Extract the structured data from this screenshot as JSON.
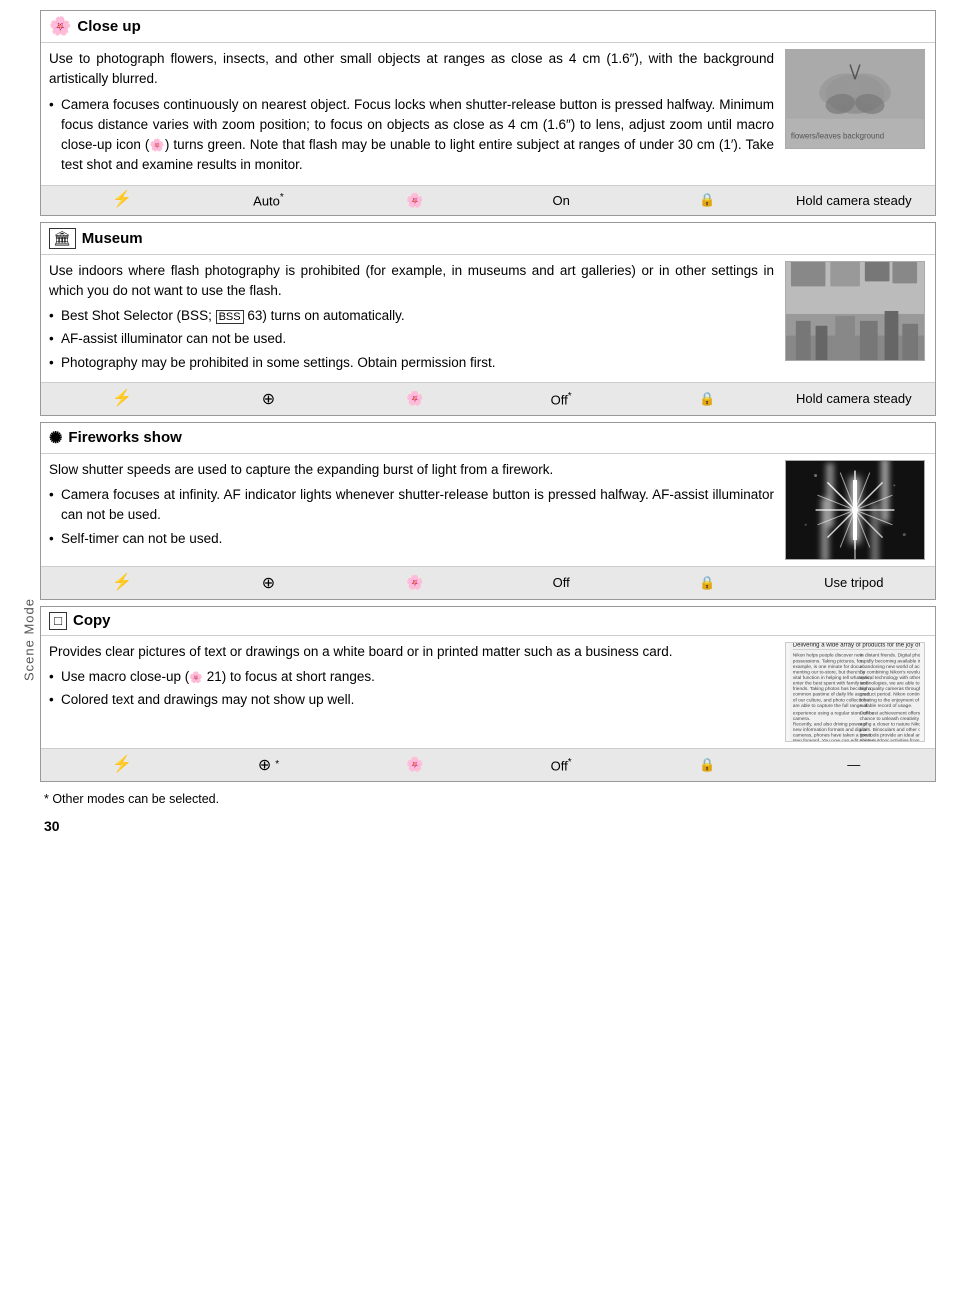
{
  "sections": [
    {
      "id": "close-up",
      "icon": "🌸",
      "title": "Close up",
      "paragraphs": [
        "Use to photograph flowers, insects, and other small objects at ranges as close as 4 cm (1.6\"), with the background artistically blurred.",
        "Camera focuses continuously on nearest object.  Focus locks when shutter-release button is pressed halfway. Minimum focus distance varies with zoom position; to focus on objects as close as 4 cm (1.6\") to lens, adjust zoom until macro close-up icon (🌸) turns green.  Note that flash may be unable to light entire subject at ranges of under 30 cm (1\").  Take test shot and examine results in monitor."
      ],
      "bullets": [],
      "status": {
        "flash": "⚡",
        "flash_label": "Auto*",
        "macro": "🌸",
        "macro_label": "On",
        "vr": "🔒",
        "vr_label": "Hold camera steady"
      },
      "image_type": "butterfly"
    },
    {
      "id": "museum",
      "icon": "🏛",
      "title": "Museum",
      "paragraphs": [
        "Use indoors where flash photography is prohibited (for example, in museums and art galleries) or in other settings in which you do not want to use the flash."
      ],
      "bullets": [
        "Best Shot Selector (BSS; 📷 63) turns on automatically.",
        "AF-assist illuminator can not be used.",
        "Photography may be prohibited in some settings.  Obtain permission first."
      ],
      "status": {
        "flash": "⚡",
        "flash_label": "⊕",
        "macro": "🌸",
        "macro_label": "Off*",
        "vr": "🔒",
        "vr_label": "Hold camera steady"
      },
      "image_type": "museum"
    },
    {
      "id": "fireworks",
      "icon": "✨",
      "title": "Fireworks show",
      "paragraphs": [
        "Slow shutter speeds are used to capture the expanding burst of light from a firework."
      ],
      "bullets": [
        "Camera focuses at infinity.  AF indicator lights whenever shutter-release button is pressed halfway.  AF-assist illuminator can not be used.",
        "Self-timer can not be used."
      ],
      "status": {
        "flash": "⚡",
        "flash_label": "⊕",
        "macro": "🌸",
        "macro_label": "Off",
        "vr": "🔒",
        "vr_label": "Use tripod"
      },
      "image_type": "fireworks"
    },
    {
      "id": "copy",
      "icon": "□",
      "title": "Copy",
      "paragraphs": [
        "Provides clear pictures of text or drawings on a white board or in printed matter such as a business card."
      ],
      "bullets": [
        "Use macro close-up (🌸 21) to focus at short ranges.",
        "Colored text and drawings may not show up well."
      ],
      "status": {
        "flash": "⚡",
        "flash_label": "⊕*",
        "macro": "🌸",
        "macro_label": "Off*",
        "vr": "🔒",
        "vr_label": "—"
      },
      "image_type": "copy"
    }
  ],
  "footnote": "* Other modes can be selected.",
  "page_number": "30",
  "side_label": "Scene Mode",
  "copy_image_text": "Delivering a wide array of products for the joy of living\n\nNikon helps people discover new possessions. Taking pictures, for example, is one minute for documenting our to-store, but there's a vital function in helping tell whatever, enter the best spent with family and friends. Taking photos has become a common pastime of daily life as part of our culture, and photo collections are able to capture the full range of experience using a regular store office camera.\n\nRecently, and also driving power of new information formats and digital cameras, phones have taken a great step forward. You now can edit photos on your computer and send them by e-mail to distant friends. Digital photos are rapidly becoming available in an almost abandoning new world of achievements. By combining Nikon's revolutionary optical technology with other advanced technologies, we are able to provide high quality cameras throughout the product period. Nikon continues contributing to the enjoyment of life in a suitable record of usage.\n\nOur best achievement offers you a chance to unleash creativity by managing a closer to nature Nikon binoculars. Binoculars and other observation tools provide an ideal answer to enjoy outdoor activities from bird watching to urban photography."
}
